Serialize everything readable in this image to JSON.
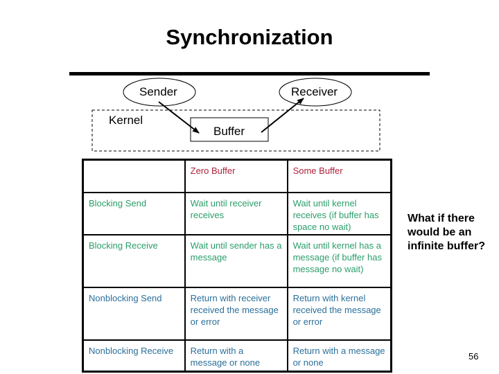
{
  "slide": {
    "title": "Synchronization",
    "page_number": "56",
    "side_question": "What if there would be an infinite buffer?"
  },
  "diagram": {
    "sender_label": "Sender",
    "receiver_label": "Receiver",
    "kernel_label": "Kernel",
    "buffer_label": "Buffer"
  },
  "table": {
    "colors": {
      "header": "#b0203a",
      "blocking": "#2a9d6a",
      "nonblocking": "#2a6f9a"
    },
    "headers": [
      "",
      "Zero Buffer",
      "Some Buffer"
    ],
    "rows": [
      {
        "label": "Blocking Send",
        "zero": "Wait until receiver receives",
        "some": "Wait until kernel receives (if buffer has space no wait)"
      },
      {
        "label": "Blocking Receive",
        "zero": "Wait until sender has a message",
        "some": "Wait until kernel has a message (if buffer has message no wait)"
      },
      {
        "label": "Nonblocking Send",
        "zero": "Return with receiver received the message or error",
        "some": "Return with kernel received the message or error"
      },
      {
        "label": "Nonblocking Receive",
        "zero": "Return with a message or none",
        "some": "Return with a message or none"
      }
    ]
  }
}
